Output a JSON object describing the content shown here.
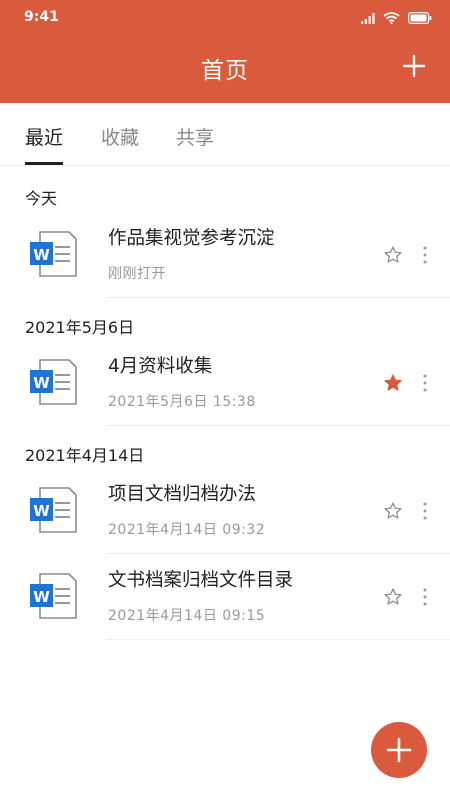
{
  "status_bar": {
    "time": "9:41"
  },
  "header": {
    "title": "首页"
  },
  "tabs": [
    {
      "label": "最近",
      "active": true
    },
    {
      "label": "收藏",
      "active": false
    },
    {
      "label": "共享",
      "active": false
    }
  ],
  "sections": [
    {
      "label": "今天",
      "items": [
        {
          "title": "作品集视觉参考沉淀",
          "subtitle": "刚刚打开",
          "starred": false
        }
      ]
    },
    {
      "label": "2021年5月6日",
      "items": [
        {
          "title": "4月资料收集",
          "subtitle": "2021年5月6日  15:38",
          "starred": true
        }
      ]
    },
    {
      "label": "2021年4月14日",
      "items": [
        {
          "title": "项目文档归档办法",
          "subtitle": "2021年4月14日  09:32",
          "starred": false
        },
        {
          "title": "文书档案归档文件目录",
          "subtitle": "2021年4月14日  09:15",
          "starred": false
        }
      ]
    }
  ],
  "icons": {
    "document": "word-document-icon",
    "star": "star-icon",
    "more": "more-vertical-icon",
    "add": "plus-icon"
  },
  "colors": {
    "accent": "#d95a3c",
    "word_blue": "#1e74d0",
    "text_primary": "#222222",
    "text_secondary": "#999999"
  }
}
